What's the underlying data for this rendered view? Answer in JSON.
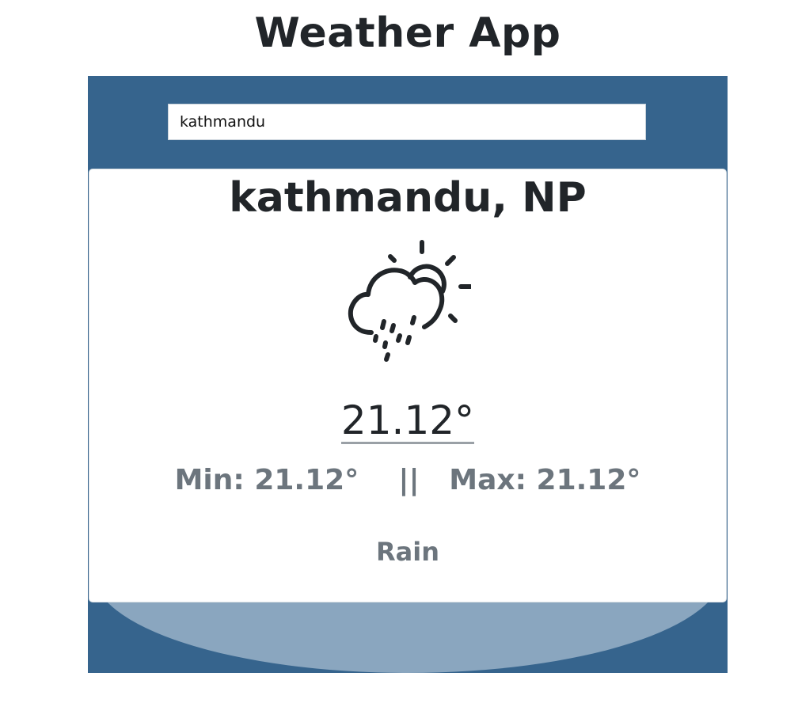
{
  "app": {
    "title": "Weather App"
  },
  "search": {
    "value": "kathmandu"
  },
  "weather": {
    "location": "kathmandu, NP",
    "icon": "rain-sun-icon",
    "temperature": "21.12°",
    "min_label": "Min: 21.12°",
    "separator": "||",
    "max_label": "Max: 21.12°",
    "condition": "Rain"
  },
  "colors": {
    "panel": "#36648d",
    "ellipse": "#8aa6bf",
    "text_dark": "#212529",
    "text_muted": "#6c757d"
  }
}
